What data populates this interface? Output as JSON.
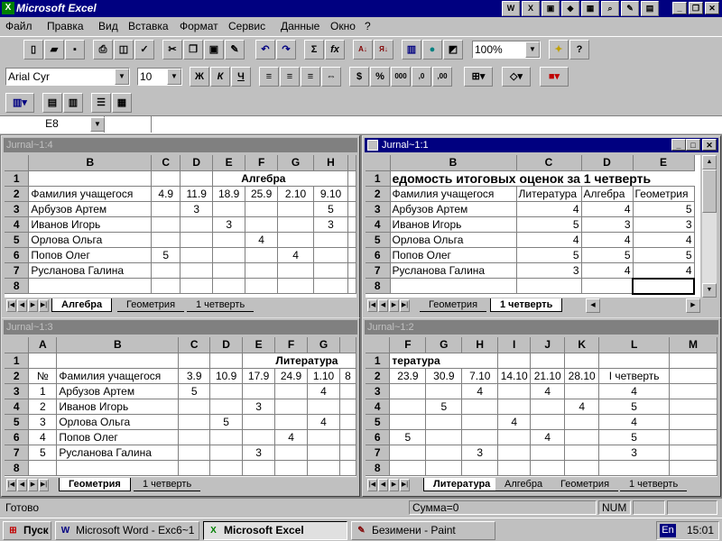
{
  "app": {
    "title": "Microsoft Excel"
  },
  "menu": [
    "Файл",
    "Правка",
    "Вид",
    "Вставка",
    "Формат",
    "Сервис",
    "Данные",
    "Окно",
    "?"
  ],
  "toolbar": {
    "zoom": "100%",
    "font": "Arial Cyr",
    "size": "10",
    "bold": "Ж",
    "italic": "К",
    "underline": "Ч"
  },
  "namebox": "E8",
  "windows": {
    "w4": {
      "title": "Jurnal~1:4",
      "cols": [
        "",
        "B",
        "C",
        "D",
        "E",
        "F",
        "G",
        "H"
      ],
      "rows": [
        {
          "n": "1",
          "cells": [
            "",
            "",
            "",
            "",
            "Алгебра",
            "",
            ""
          ]
        },
        {
          "n": "2",
          "cells": [
            "Фамилия учащегося",
            "4.9",
            "11.9",
            "18.9",
            "25.9",
            "2.10",
            "9.10"
          ]
        },
        {
          "n": "3",
          "cells": [
            "Арбузов Артем",
            "",
            "3",
            "",
            "",
            "",
            "5"
          ]
        },
        {
          "n": "4",
          "cells": [
            "Иванов Игорь",
            "",
            "",
            "3",
            "",
            "",
            "3"
          ]
        },
        {
          "n": "5",
          "cells": [
            "Орлова Ольга",
            "",
            "",
            "",
            "4",
            "",
            ""
          ]
        },
        {
          "n": "6",
          "cells": [
            "Попов Олег",
            "5",
            "",
            "",
            "",
            "4",
            ""
          ]
        },
        {
          "n": "7",
          "cells": [
            "Русланова Галина",
            "",
            "",
            "",
            "",
            "",
            ""
          ]
        },
        {
          "n": "8",
          "cells": [
            "",
            "",
            "",
            "",
            "",
            "",
            ""
          ]
        }
      ],
      "tabs": [
        "Алгебра",
        "Геометрия",
        "1 четверть"
      ]
    },
    "w1": {
      "title": "Jurnal~1:1",
      "cols": [
        "",
        "B",
        "C",
        "D",
        "E"
      ],
      "heading": "едомость итоговых оценок за 1 четверть",
      "rows": [
        {
          "n": "2",
          "cells": [
            "Фамилия учащегося",
            "Литература",
            "Алгебра",
            "Геометрия"
          ]
        },
        {
          "n": "3",
          "cells": [
            "Арбузов Артем",
            "4",
            "4",
            "5"
          ]
        },
        {
          "n": "4",
          "cells": [
            "Иванов Игорь",
            "5",
            "3",
            "3"
          ]
        },
        {
          "n": "5",
          "cells": [
            "Орлова Ольга",
            "4",
            "4",
            "4"
          ]
        },
        {
          "n": "6",
          "cells": [
            "Попов Олег",
            "5",
            "5",
            "5"
          ]
        },
        {
          "n": "7",
          "cells": [
            "Русланова Галина",
            "3",
            "4",
            "4"
          ]
        },
        {
          "n": "8",
          "cells": [
            "",
            "",
            "",
            ""
          ]
        }
      ],
      "tabs": [
        "Геометрия",
        "1 четверть"
      ]
    },
    "w3": {
      "title": "Jurnal~1:3",
      "cols": [
        "",
        "A",
        "B",
        "C",
        "D",
        "E",
        "F",
        "G",
        ""
      ],
      "rows": [
        {
          "n": "1",
          "cells": [
            "",
            "",
            "",
            "",
            "",
            "Литература",
            "",
            ""
          ]
        },
        {
          "n": "2",
          "cells": [
            "№",
            "Фамилия учащегося",
            "3.9",
            "10.9",
            "17.9",
            "24.9",
            "1.10",
            "8"
          ]
        },
        {
          "n": "3",
          "cells": [
            "1",
            "Арбузов Артем",
            "5",
            "",
            "",
            "",
            "4",
            ""
          ]
        },
        {
          "n": "4",
          "cells": [
            "2",
            "Иванов Игорь",
            "",
            "",
            "3",
            "",
            "",
            ""
          ]
        },
        {
          "n": "5",
          "cells": [
            "3",
            "Орлова Ольга",
            "",
            "5",
            "",
            "",
            "4",
            ""
          ]
        },
        {
          "n": "6",
          "cells": [
            "4",
            "Попов Олег",
            "",
            "",
            "",
            "4",
            "",
            ""
          ]
        },
        {
          "n": "7",
          "cells": [
            "5",
            "Русланова Галина",
            "",
            "",
            "3",
            "",
            "",
            ""
          ]
        },
        {
          "n": "8",
          "cells": [
            "",
            "",
            "",
            "",
            "",
            "",
            "",
            ""
          ]
        }
      ],
      "tabs": [
        "Геометрия",
        "1 четверть"
      ]
    },
    "w2": {
      "title": "Jurnal~1:2",
      "cols": [
        "",
        "F",
        "G",
        "H",
        "I",
        "J",
        "K",
        "L",
        "M"
      ],
      "rows": [
        {
          "n": "1",
          "cells": [
            "тература",
            "",
            "",
            "",
            "",
            "",
            "",
            ""
          ]
        },
        {
          "n": "2",
          "cells": [
            "23.9",
            "30.9",
            "7.10",
            "14.10",
            "21.10",
            "28.10",
            "I четверть",
            ""
          ]
        },
        {
          "n": "3",
          "cells": [
            "",
            "",
            "4",
            "",
            "4",
            "",
            "4",
            ""
          ]
        },
        {
          "n": "4",
          "cells": [
            "",
            "5",
            "",
            "",
            "",
            "4",
            "5",
            ""
          ]
        },
        {
          "n": "5",
          "cells": [
            "",
            "",
            "",
            "4",
            "",
            "",
            "4",
            ""
          ]
        },
        {
          "n": "6",
          "cells": [
            "5",
            "",
            "",
            "",
            "4",
            "",
            "5",
            ""
          ]
        },
        {
          "n": "7",
          "cells": [
            "",
            "",
            "3",
            "",
            "",
            "",
            "3",
            ""
          ]
        },
        {
          "n": "8",
          "cells": [
            "",
            "",
            "",
            "",
            "",
            "",
            "",
            ""
          ]
        }
      ],
      "tabs": [
        "Литература",
        "Алгебра",
        "Геометрия",
        "1 четверть"
      ]
    }
  },
  "status": {
    "ready": "Готово",
    "sum": "Сумма=0",
    "num": "NUM"
  },
  "taskbar": {
    "start": "Пуск",
    "tasks": [
      "Microsoft Word - Exc6~1",
      "Microsoft Excel",
      "Безимени - Paint"
    ],
    "lang": "En",
    "clock": "15:01"
  }
}
